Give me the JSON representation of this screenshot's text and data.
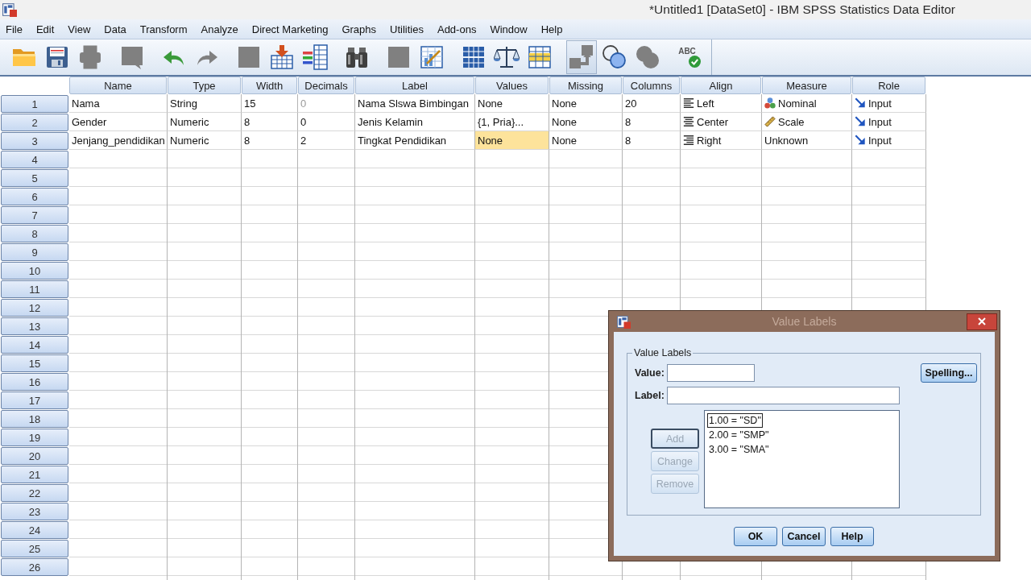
{
  "window": {
    "title": "*Untitled1 [DataSet0] - IBM SPSS Statistics Data Editor"
  },
  "menu": [
    "File",
    "Edit",
    "View",
    "Data",
    "Transform",
    "Analyze",
    "Direct Marketing",
    "Graphs",
    "Utilities",
    "Add-ons",
    "Window",
    "Help"
  ],
  "toolbar": [
    {
      "disabled": false,
      "pressed": false
    },
    {
      "disabled": false,
      "pressed": false
    },
    {
      "disabled": true,
      "pressed": false
    },
    {
      "disabled": true,
      "pressed": false
    },
    {
      "disabled": false,
      "pressed": false
    },
    {
      "disabled": true,
      "pressed": false
    },
    {
      "disabled": true,
      "pressed": false
    },
    {
      "disabled": false,
      "pressed": false
    },
    {
      "disabled": false,
      "pressed": false
    },
    {
      "disabled": false,
      "pressed": false
    },
    {
      "disabled": true,
      "pressed": false
    },
    {
      "disabled": false,
      "pressed": false
    },
    {
      "disabled": false,
      "pressed": false
    },
    {
      "disabled": false,
      "pressed": false
    },
    {
      "disabled": false,
      "pressed": false
    },
    {
      "disabled": true,
      "pressed": true
    },
    {
      "disabled": false,
      "pressed": false
    },
    {
      "disabled": true,
      "pressed": false
    },
    {
      "label": "ABC",
      "disabled": false,
      "pressed": false
    }
  ],
  "table": {
    "columns": [
      "Name",
      "Type",
      "Width",
      "Decimals",
      "Label",
      "Values",
      "Missing",
      "Columns",
      "Align",
      "Measure",
      "Role"
    ],
    "row_headers": [
      "1",
      "2",
      "3",
      "4",
      "5",
      "6",
      "7",
      "8",
      "9",
      "10",
      "11",
      "12",
      "13",
      "14",
      "15",
      "16",
      "17",
      "18",
      "19",
      "20",
      "21",
      "22",
      "23",
      "24",
      "25",
      "26"
    ],
    "rows": [
      {
        "cells": [
          {
            "text": "Nama",
            "kind": "text",
            "selected": false,
            "disabled": false
          },
          {
            "text": "String",
            "kind": "text",
            "selected": false,
            "disabled": false
          },
          {
            "text": "15",
            "kind": "text",
            "selected": false,
            "disabled": false
          },
          {
            "text": "0",
            "kind": "text",
            "selected": false,
            "disabled": true
          },
          {
            "text": "Nama Slswa Bimbingan",
            "kind": "text",
            "selected": false,
            "disabled": false
          },
          {
            "text": "None",
            "kind": "text",
            "selected": false,
            "disabled": false
          },
          {
            "text": "None",
            "kind": "text",
            "selected": false,
            "disabled": false
          },
          {
            "text": "20",
            "kind": "text",
            "selected": false,
            "disabled": false
          },
          {
            "text": "Left",
            "kind": "align_left",
            "selected": false,
            "disabled": false
          },
          {
            "text": "Nominal",
            "kind": "nominal",
            "selected": false,
            "disabled": false
          },
          {
            "text": "Input",
            "kind": "input",
            "selected": false,
            "disabled": false
          }
        ]
      },
      {
        "cells": [
          {
            "text": "Gender",
            "kind": "text",
            "selected": false,
            "disabled": false
          },
          {
            "text": "Numeric",
            "kind": "text",
            "selected": false,
            "disabled": false
          },
          {
            "text": "8",
            "kind": "text",
            "selected": false,
            "disabled": false
          },
          {
            "text": "0",
            "kind": "text",
            "selected": false,
            "disabled": false
          },
          {
            "text": "Jenis Kelamin",
            "kind": "text",
            "selected": false,
            "disabled": false
          },
          {
            "text": "{1, Pria}...",
            "kind": "text",
            "selected": false,
            "disabled": false
          },
          {
            "text": "None",
            "kind": "text",
            "selected": false,
            "disabled": false
          },
          {
            "text": "8",
            "kind": "text",
            "selected": false,
            "disabled": false
          },
          {
            "text": "Center",
            "kind": "align_center",
            "selected": false,
            "disabled": false
          },
          {
            "text": "Scale",
            "kind": "scale",
            "selected": false,
            "disabled": false
          },
          {
            "text": "Input",
            "kind": "input",
            "selected": false,
            "disabled": false
          }
        ]
      },
      {
        "cells": [
          {
            "text": "Jenjang_pendidikan",
            "kind": "text",
            "selected": false,
            "disabled": false
          },
          {
            "text": "Numeric",
            "kind": "text",
            "selected": false,
            "disabled": false
          },
          {
            "text": "8",
            "kind": "text",
            "selected": false,
            "disabled": false
          },
          {
            "text": "2",
            "kind": "text",
            "selected": false,
            "disabled": false
          },
          {
            "text": "Tingkat Pendidikan",
            "kind": "text",
            "selected": false,
            "disabled": false
          },
          {
            "text": "None",
            "kind": "text",
            "selected": true,
            "disabled": false
          },
          {
            "text": "None",
            "kind": "text",
            "selected": false,
            "disabled": false
          },
          {
            "text": "8",
            "kind": "text",
            "selected": false,
            "disabled": false
          },
          {
            "text": "Right",
            "kind": "align_right",
            "selected": false,
            "disabled": false
          },
          {
            "text": "Unknown",
            "kind": "text",
            "selected": false,
            "disabled": false
          },
          {
            "text": "Input",
            "kind": "input",
            "selected": false,
            "disabled": false
          }
        ]
      }
    ]
  },
  "dialog": {
    "title": "Value Labels",
    "group_label": "Value Labels",
    "fields": [
      {
        "label": "Value:"
      },
      {
        "label": "Label:"
      }
    ],
    "spelling_button": "Spelling...",
    "list": [
      {
        "text": "1.00 = \"SD\"",
        "selected": true
      },
      {
        "text": "2.00 = \"SMP\"",
        "selected": false
      },
      {
        "text": "3.00 = \"SMA\"",
        "selected": false
      }
    ],
    "side_buttons": [
      {
        "label": "Add",
        "disabled": true,
        "default": true
      },
      {
        "label": "Change",
        "disabled": true,
        "default": false
      },
      {
        "label": "Remove",
        "disabled": true,
        "default": false
      }
    ],
    "buttons": [
      {
        "label": "OK"
      },
      {
        "label": "Cancel"
      },
      {
        "label": "Help"
      }
    ]
  }
}
